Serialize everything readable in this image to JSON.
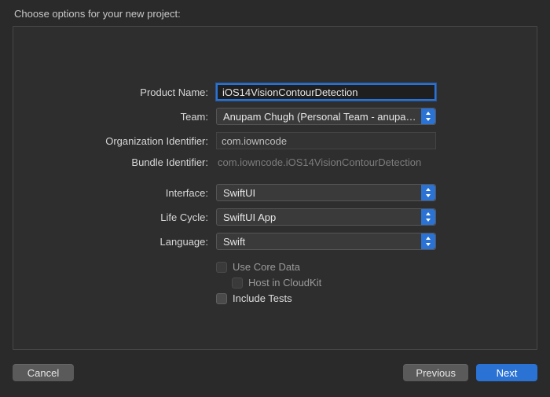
{
  "header": {
    "title": "Choose options for your new project:"
  },
  "form": {
    "productName": {
      "label": "Product Name:",
      "value": "iOS14VisionContourDetection"
    },
    "team": {
      "label": "Team:",
      "value": "Anupam Chugh (Personal Team - anupam…"
    },
    "orgId": {
      "label": "Organization Identifier:",
      "value": "com.iowncode"
    },
    "bundleId": {
      "label": "Bundle Identifier:",
      "value": "com.iowncode.iOS14VisionContourDetection"
    },
    "interface": {
      "label": "Interface:",
      "value": "SwiftUI"
    },
    "lifeCycle": {
      "label": "Life Cycle:",
      "value": "SwiftUI App"
    },
    "language": {
      "label": "Language:",
      "value": "Swift"
    },
    "useCoreData": {
      "label": "Use Core Data"
    },
    "hostCloudKit": {
      "label": "Host in CloudKit"
    },
    "includeTests": {
      "label": "Include Tests"
    }
  },
  "buttons": {
    "cancel": "Cancel",
    "previous": "Previous",
    "next": "Next"
  }
}
